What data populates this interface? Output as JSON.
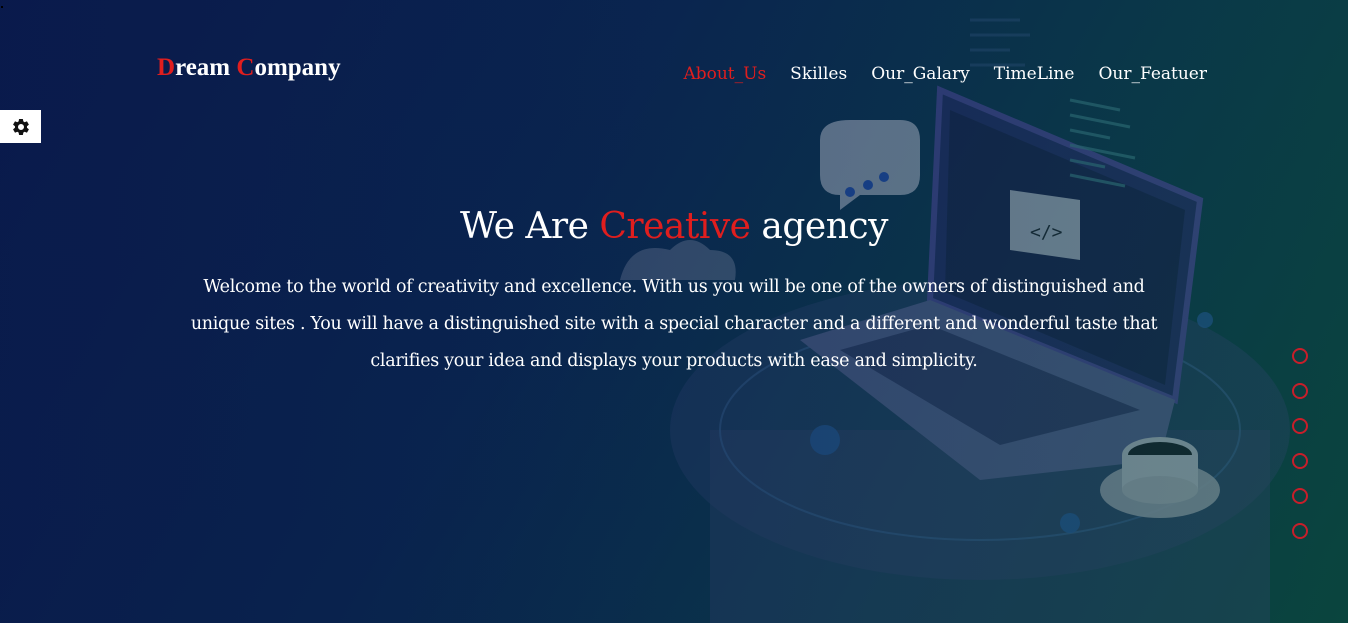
{
  "brand": {
    "first_initial": "D",
    "first_rest": "ream ",
    "second_initial": "C",
    "second_rest": "ompany"
  },
  "nav": {
    "items": [
      {
        "label": "About_Us",
        "active": true
      },
      {
        "label": "Skilles",
        "active": false
      },
      {
        "label": "Our_Galary",
        "active": false
      },
      {
        "label": "TimeLine",
        "active": false
      },
      {
        "label": "Our_Featuer",
        "active": false
      }
    ]
  },
  "settings": {
    "icon": "gear-icon"
  },
  "hero": {
    "title_before": "We Are ",
    "title_accent": "Creative",
    "title_after": " agency",
    "text": "Welcome to the world of creativity and excellence. With us you will be one of the owners of distinguished and unique sites . You will have a distinguished site with a special character and a different and wonderful taste that clarifies your idea and displays your products with ease and simplicity."
  },
  "bullets": {
    "count": 6,
    "color": "#c81e2a"
  },
  "colors": {
    "accent": "#e01e1e",
    "background_start": "#0b1f52",
    "background_end": "#0a4a3e"
  }
}
